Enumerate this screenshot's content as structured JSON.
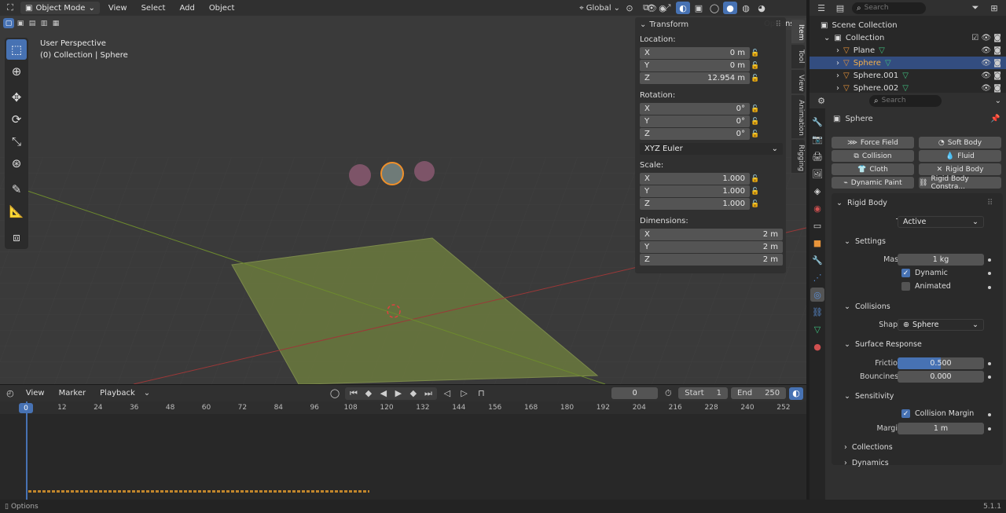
{
  "header": {
    "mode": "Object Mode",
    "menus": [
      "View",
      "Select",
      "Add",
      "Object"
    ],
    "orientation": "Global",
    "options_label": "Options"
  },
  "viewport": {
    "title": "User Perspective",
    "subtitle": "(0) Collection | Sphere"
  },
  "npanel": {
    "title": "Transform",
    "location_label": "Location:",
    "location": [
      {
        "axis": "X",
        "value": "0 m"
      },
      {
        "axis": "Y",
        "value": "0 m"
      },
      {
        "axis": "Z",
        "value": "12.954 m"
      }
    ],
    "rotation_label": "Rotation:",
    "rotation": [
      {
        "axis": "X",
        "value": "0°"
      },
      {
        "axis": "Y",
        "value": "0°"
      },
      {
        "axis": "Z",
        "value": "0°"
      }
    ],
    "rotation_mode": "XYZ Euler",
    "scale_label": "Scale:",
    "scale": [
      {
        "axis": "X",
        "value": "1.000"
      },
      {
        "axis": "Y",
        "value": "1.000"
      },
      {
        "axis": "Z",
        "value": "1.000"
      }
    ],
    "dimensions_label": "Dimensions:",
    "dimensions": [
      {
        "axis": "X",
        "value": "2 m"
      },
      {
        "axis": "Y",
        "value": "2 m"
      },
      {
        "axis": "Z",
        "value": "2 m"
      }
    ],
    "tabs": [
      "Item",
      "Tool",
      "View",
      "Animation",
      "Rigging"
    ]
  },
  "timeline": {
    "menus": [
      "View",
      "Marker",
      "Playback"
    ],
    "current_frame": "0",
    "start_label": "Start",
    "start": "1",
    "end_label": "End",
    "end": "250",
    "ticks": [
      "0",
      "12",
      "24",
      "36",
      "48",
      "60",
      "72",
      "84",
      "96",
      "108",
      "120",
      "132",
      "144",
      "156",
      "168",
      "180",
      "192",
      "204",
      "216",
      "228",
      "240",
      "252"
    ]
  },
  "outliner": {
    "search_placeholder": "Search",
    "scene_collection": "Scene Collection",
    "collection": "Collection",
    "items": [
      "Plane",
      "Sphere",
      "Sphere.001",
      "Sphere.002"
    ]
  },
  "properties": {
    "search_placeholder": "Search",
    "object_name": "Sphere",
    "physics_buttons": [
      "Force Field",
      "Soft Body",
      "Collision",
      "Fluid",
      "Cloth",
      "Rigid Body",
      "Dynamic Paint",
      "Rigid Body Constra..."
    ],
    "rigid_body": {
      "title": "Rigid Body",
      "type_label": "Type",
      "type_value": "Active",
      "settings_title": "Settings",
      "mass_label": "Mass",
      "mass_value": "1 kg",
      "dynamic_label": "Dynamic",
      "animated_label": "Animated",
      "collisions_title": "Collisions",
      "shape_label": "Shape",
      "shape_value": "Sphere",
      "surface_title": "Surface Response",
      "friction_label": "Friction",
      "friction_value": "0.500",
      "friction_fraction": 0.5,
      "bounciness_label": "Bounciness",
      "bounciness_value": "0.000",
      "sensitivity_title": "Sensitivity",
      "collision_margin_label": "Collision Margin",
      "margin_label": "Margin",
      "margin_value": "1 m",
      "collections_title": "Collections",
      "dynamics_title": "Dynamics"
    }
  },
  "status": {
    "left": "Options",
    "version": "5.1.1"
  },
  "colors": {
    "accent": "#4772b3",
    "plane": "#6b7a3e",
    "sphere": "#7d5468"
  }
}
